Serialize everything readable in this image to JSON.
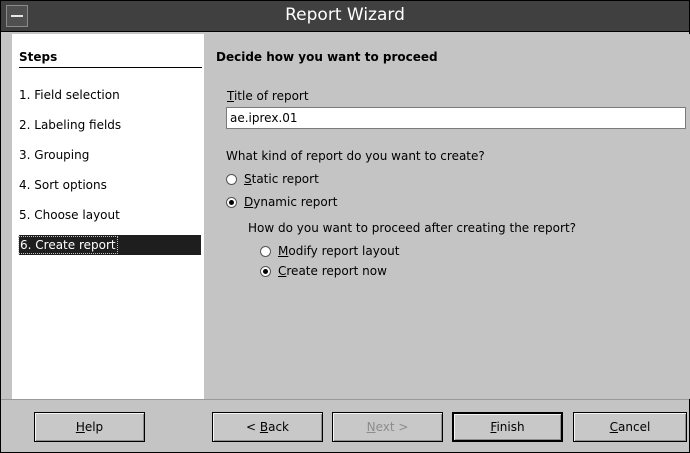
{
  "window": {
    "title": "Report Wizard"
  },
  "steps": {
    "heading": "Steps",
    "items": [
      {
        "label": "1. Field selection"
      },
      {
        "label": "2. Labeling fields"
      },
      {
        "label": "3. Grouping"
      },
      {
        "label": "4. Sort options"
      },
      {
        "label": "5. Choose layout"
      },
      {
        "label": "6. Create report",
        "active": true
      }
    ]
  },
  "content": {
    "heading": "Decide how you want to proceed",
    "title_label_mnemonic": "T",
    "title_label_rest": "itle of report",
    "title_value": "ae.iprex.01",
    "question1": "What kind of report do you want to create?",
    "static_mnemonic": "S",
    "static_rest": "tatic report",
    "dynamic_mnemonic": "D",
    "dynamic_rest": "ynamic report",
    "report_type_selected": "Dynamic report",
    "question2": "How do you want to proceed after creating the report?",
    "modify_mnemonic": "M",
    "modify_rest": "odify report layout",
    "create_mnemonic": "C",
    "create_rest": "reate report now",
    "proceed_selected": "Create report now"
  },
  "buttons": {
    "help_mnemonic": "H",
    "help_rest": "elp",
    "back_prefix": "< ",
    "back_mnemonic": "B",
    "back_rest": "ack",
    "next_mnemonic": "N",
    "next_rest": "ext >",
    "finish_mnemonic": "F",
    "finish_rest": "inish",
    "cancel_mnemonic": "C",
    "cancel_rest": "ancel"
  }
}
